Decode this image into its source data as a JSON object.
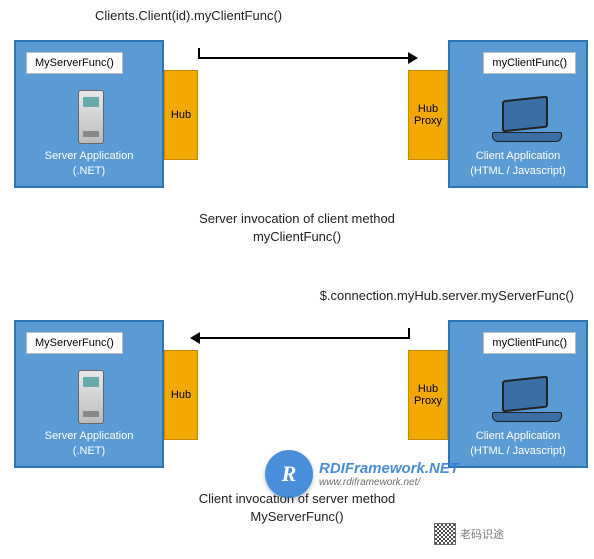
{
  "top": {
    "code": "Clients.Client(id).myClientFunc()",
    "server_tag": "MyServerFunc()",
    "client_tag": "myClientFunc()",
    "hub": "Hub",
    "hubproxy": "Hub Proxy",
    "server_caption_l1": "Server Application",
    "server_caption_l2": "(.NET)",
    "client_caption_l1": "Client Application",
    "client_caption_l2": "(HTML / Javascript)",
    "desc_l1": "Server invocation of client method",
    "desc_l2": "myClientFunc()"
  },
  "bottom": {
    "code": "$.connection.myHub.server.myServerFunc()",
    "server_tag": "MyServerFunc()",
    "client_tag": "myClientFunc()",
    "hub": "Hub",
    "hubproxy": "Hub Proxy",
    "server_caption_l1": "Server Application",
    "server_caption_l2": "(.NET)",
    "client_caption_l1": "Client Application",
    "client_caption_l2": "(HTML / Javascript)",
    "desc_l1": "Client invocation of server method",
    "desc_l2": "MyServerFunc()"
  },
  "watermark": {
    "badge": "R",
    "title": "RDIFramework.NET",
    "subtitle": "www.rdiframework.net/",
    "qr_label": "老码识途"
  }
}
